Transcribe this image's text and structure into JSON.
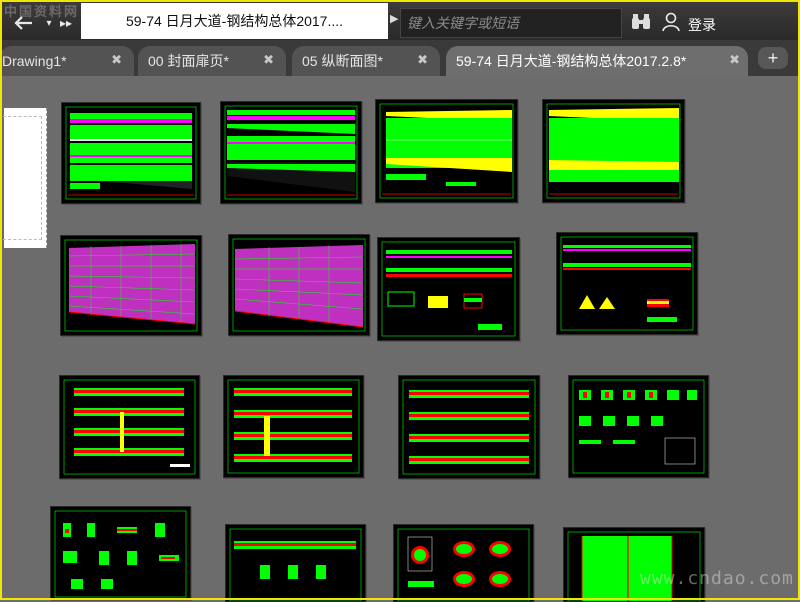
{
  "watermark_top": "中国资料网",
  "watermark_bottom": "www.cndao.com",
  "titlebar": {
    "back_icon": "back-arrow-icon",
    "forward_icon": "double-chevron-right-icon",
    "document_title": "59-74 日月大道-钢结构总体2017....",
    "search_placeholder": "键入关键字或短语",
    "search_icon": "binoculars-icon",
    "user_icon": "user-icon",
    "login_label": "登录"
  },
  "tabs": [
    {
      "label": "Drawing1*"
    },
    {
      "label": "00 封面扉页*"
    },
    {
      "label": "05 纵断面图*"
    },
    {
      "label": "59-74 日月大道-钢结构总体2017.2.8*"
    }
  ],
  "add_tab_label": "+",
  "colors": {
    "frame": "#f2e600",
    "green": "#00ff00",
    "magenta": "#ff00ff",
    "yellow": "#ffff00",
    "red": "#ff2020",
    "white": "#ffffff"
  }
}
